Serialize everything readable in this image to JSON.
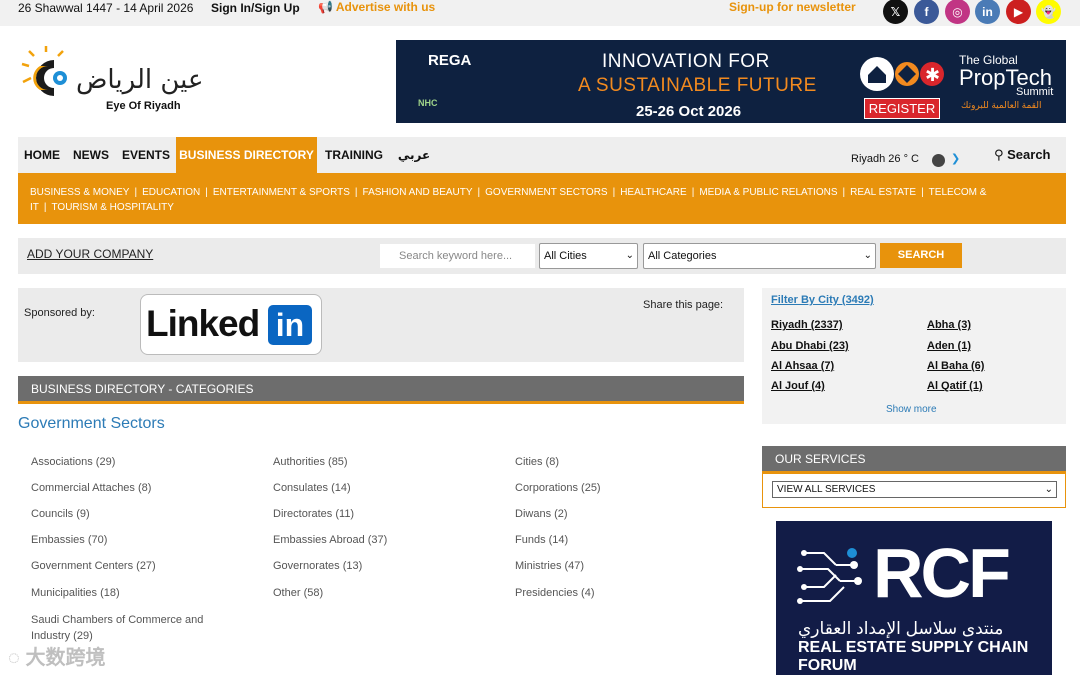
{
  "topbar": {
    "date": "26 Shawwal 1447 - 14 April 2026",
    "signin": "Sign In/Sign Up",
    "advertise": "Advertise with us",
    "newsletter": "Sign-up for newsletter",
    "social": [
      {
        "icon": "x-icon",
        "glyph": "𝕏",
        "color": "#111111"
      },
      {
        "icon": "facebook-icon",
        "glyph": "f",
        "color": "#3b5998"
      },
      {
        "icon": "instagram-icon",
        "glyph": "◎",
        "color": "#c13584"
      },
      {
        "icon": "linkedin-icon",
        "glyph": "in",
        "color": "#4a7bb6"
      },
      {
        "icon": "youtube-icon",
        "glyph": "▶",
        "color": "#cc1f1f"
      },
      {
        "icon": "snapchat-icon",
        "glyph": "👻",
        "color": "#fffc00"
      }
    ]
  },
  "logo": {
    "subtitle": "Eye Of Riyadh"
  },
  "banner": {
    "line1": "INNOVATION FOR",
    "line2": "A SUSTAINABLE FUTURE",
    "dates": "25-26 Oct 2026",
    "rega": "REGA",
    "nhc": "NHC",
    "register": "REGISTER",
    "pt_the": "The Global",
    "pt_name": "PropTech",
    "pt_summit": "Summit",
    "pt_ar": "القمة العالمية للبروتك"
  },
  "mainnav": {
    "items": [
      {
        "label": "HOME",
        "active": false
      },
      {
        "label": "NEWS",
        "active": false
      },
      {
        "label": "EVENTS",
        "active": false
      },
      {
        "label": "BUSINESS DIRECTORY",
        "active": true
      },
      {
        "label": "TRAINING",
        "active": false
      },
      {
        "label": "عربي",
        "active": false
      }
    ],
    "weather": "Riyadh 26 ° C",
    "search": "Search"
  },
  "subnav": {
    "items": [
      "BUSINESS & MONEY",
      "EDUCATION",
      "ENTERTAINMENT & SPORTS",
      "FASHION AND BEAUTY",
      "GOVERNMENT SECTORS",
      "HEALTHCARE",
      "MEDIA & PUBLIC RELATIONS",
      "REAL ESTATE",
      "TELECOM & IT",
      "TOURISM & HOSPITALITY"
    ]
  },
  "dirbar": {
    "add_company": "ADD YOUR COMPANY",
    "keyword_placeholder": "Search keyword here...",
    "city_value": "All Cities",
    "category_value": "All Categories",
    "search_button": "SEARCH"
  },
  "sponsor": {
    "label": "Sponsored by:",
    "brand_text": "Linked",
    "brand_in": "in",
    "share": "Share this page:"
  },
  "categories": {
    "header": "BUSINESS DIRECTORY - CATEGORIES",
    "section": "Government Sectors",
    "columns": [
      [
        "Associations (29)",
        "Commercial Attaches (8)",
        "Councils (9)",
        "Embassies (70)",
        "Government Centers (27)",
        "Municipalities (18)",
        "Saudi Chambers of Commerce and Industry (29)"
      ],
      [
        "Authorities (85)",
        "Consulates (14)",
        "Directorates (11)",
        "Embassies Abroad (37)",
        "Governorates (13)",
        "Other (58)"
      ],
      [
        "Cities (8)",
        "Corporations (25)",
        "Diwans (2)",
        "Funds (14)",
        "Ministries (47)",
        "Presidencies (4)"
      ]
    ]
  },
  "filter": {
    "title": "Filter By City (3492)",
    "left": [
      "Riyadh (2337)",
      "Abu Dhabi (23)",
      "Al Ahsaa (7)",
      "Al Jouf (4)"
    ],
    "right": [
      "Abha (3)",
      "Aden (1)",
      "Al Baha (6)",
      "Al Qatif (1)"
    ],
    "more": "Show more"
  },
  "services": {
    "header": "OUR SERVICES",
    "select_value": "VIEW ALL SERVICES"
  },
  "rcf": {
    "big": "RCF",
    "arabic": "منتدى سلاسل الإمداد العقاري",
    "english": "REAL ESTATE SUPPLY CHAIN FORUM"
  },
  "watermark": "大数跨境"
}
